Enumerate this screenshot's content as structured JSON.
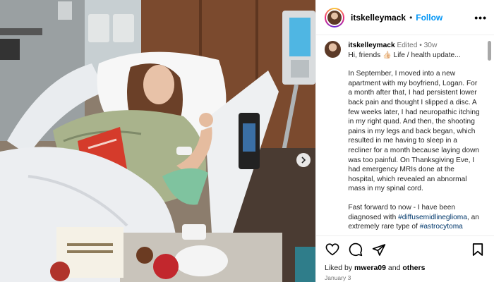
{
  "post": {
    "username": "itskelleymack",
    "follow_label": "Follow",
    "header_separator": "•",
    "more_label": "•••"
  },
  "caption": {
    "username": "itskelleymack",
    "edited": "Edited",
    "separator": "•",
    "age": "30w",
    "greeting": "Hi, friends 👍🏻 Life / health update...",
    "paragraph1": "In September, I moved into a new apartment with my boyfriend, Logan. For a month after that, I had persistent lower back pain and thought I slipped a disc. A few weeks later, I had neuropathic itching in my right quad. And then, the shooting pains in my legs and back began, which resulted in me having to sleep in a recliner for a month because laying down was too painful. On Thanksgiving Eve, I had emergency MRIs done at the hospital, which revealed an abnormal mass in my spinal cord.",
    "paragraph2_text": "Fast forward to now - I have been diagnosed with ",
    "paragraph2_hashtag": "#diffusemidlineglioma",
    "paragraph2_cont": ", an extremely rare type of ",
    "paragraph2_hashtag2": "#astrocytoma"
  },
  "likes": {
    "prefix": "Liked by ",
    "user": "mwera09",
    "middle": " and ",
    "others": "others"
  },
  "date": "January 3",
  "icons": {
    "like": "heart-icon",
    "comment": "comment-icon",
    "share": "share-icon",
    "save": "bookmark-icon",
    "next": "chevron-right-icon"
  },
  "colors": {
    "accent": "#0095f6",
    "hashtag": "#00376b",
    "secondary_text": "#737373"
  }
}
